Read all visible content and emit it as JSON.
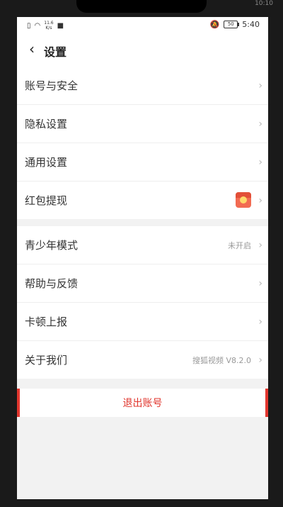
{
  "outer_status": {
    "time": "10:10"
  },
  "statusbar": {
    "speed_value": "11.6",
    "speed_unit": "K/s",
    "battery_level": "50",
    "time": "5:40"
  },
  "header": {
    "title": "设置"
  },
  "group1": [
    {
      "label": "账号与安全"
    },
    {
      "label": "隐私设置"
    },
    {
      "label": "通用设置"
    },
    {
      "label": "红包提现"
    }
  ],
  "group2": [
    {
      "label": "青少年模式",
      "value": "未开启"
    },
    {
      "label": "帮助与反馈"
    },
    {
      "label": "卡顿上报"
    },
    {
      "label": "关于我们",
      "value": "搜狐视频 V8.2.0"
    }
  ],
  "logout": {
    "label": "退出账号"
  },
  "colors": {
    "accent": "#e0352c",
    "background": "#f2f2f2",
    "redpacket": "#f26b52"
  }
}
